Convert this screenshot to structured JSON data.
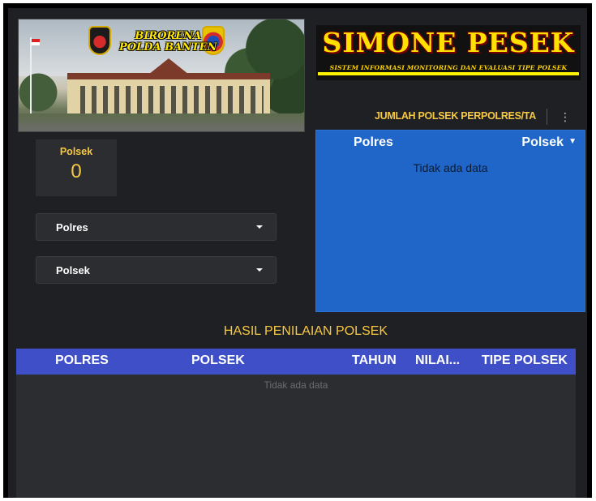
{
  "banner": {
    "title_line1": "BIRORENA",
    "title_line2": "POLDA BANTEN"
  },
  "brand": {
    "title": "SIMONE PESEK",
    "subtitle": "SISTEM INFORMASI MONITORING DAN EVALUASI TIPE POLSEK",
    "title_color": "#ffe100"
  },
  "scorecard": {
    "label": "Polsek",
    "value": "0"
  },
  "filters": {
    "polres": {
      "label": "Polres"
    },
    "polsek": {
      "label": "Polsek"
    }
  },
  "jumlah_chart": {
    "title": "JUMLAH POLSEK PERPOLRES/TA",
    "columns": [
      "Polres",
      "Polsek"
    ],
    "sort_icon": "caret-down-icon",
    "empty_text": "Tidak ada data",
    "background_color": "#1f66c8"
  },
  "hasil": {
    "title": "HASIL PENILAIAN POLSEK",
    "columns": [
      "POLRES",
      "POLSEK",
      "TAHUN",
      "NILAI...",
      "TIPE POLSEK"
    ],
    "empty_text": "Tidak ada data",
    "header_color": "#3f4fc8"
  },
  "accent_color": "#f7c844"
}
